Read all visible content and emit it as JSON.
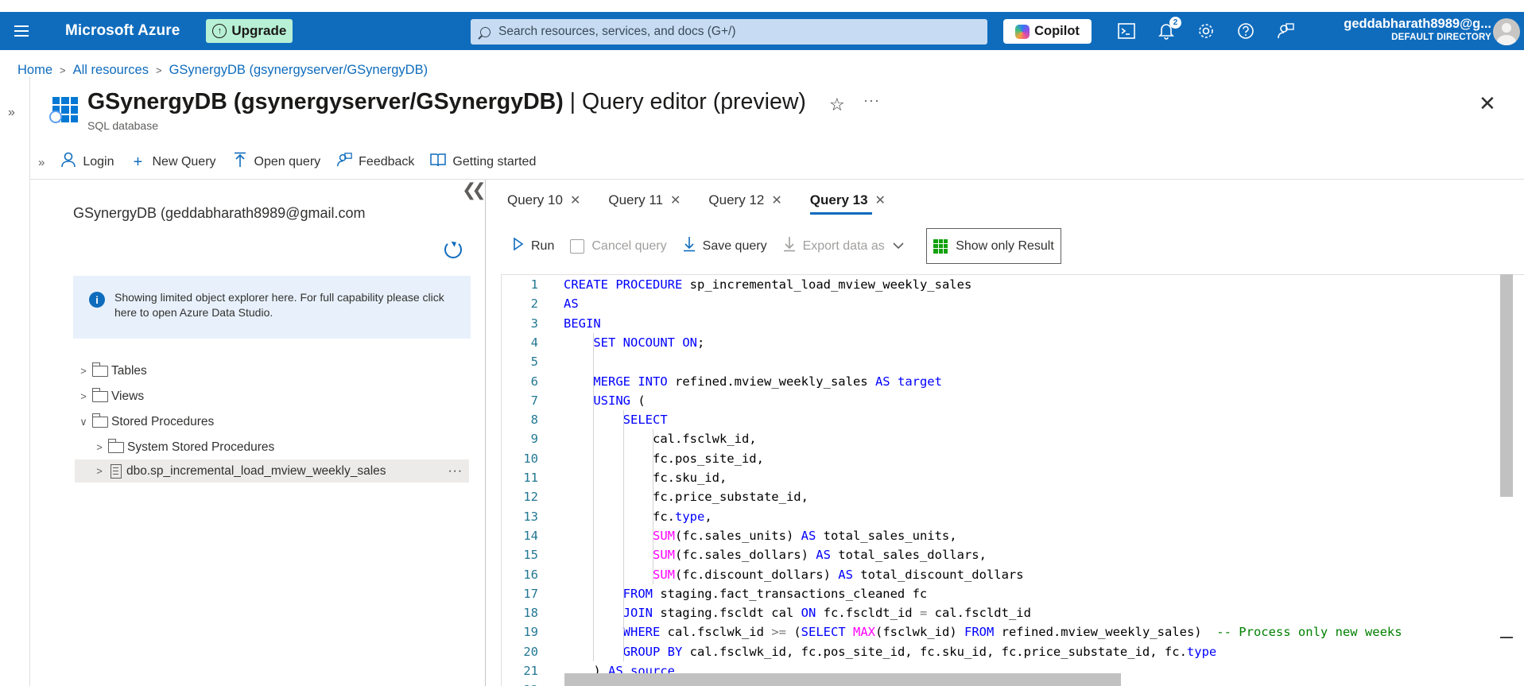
{
  "topbar": {
    "brand": "Microsoft Azure",
    "upgrade_label": "Upgrade",
    "search_placeholder": "Search resources, services, and docs (G+/)",
    "copilot_label": "Copilot",
    "notification_count": "2",
    "account_name": "geddabharath8989@g...",
    "account_directory": "DEFAULT DIRECTORY"
  },
  "breadcrumb": [
    "Home",
    "All resources",
    "GSynergyDB (gsynergyserver/GSynergyDB)"
  ],
  "header": {
    "title_main": "GSynergyDB (gsynergyserver/GSynergyDB)",
    "title_sub": " | Query editor (preview)",
    "subtitle": "SQL database"
  },
  "commands": [
    "Login",
    "New Query",
    "Open query",
    "Feedback",
    "Getting started"
  ],
  "explorer": {
    "db_label": "GSynergyDB (geddabharath8989@gmail.com",
    "info_text": "Showing limited object explorer here. For full capability please click here to open Azure Data Studio.",
    "tree": {
      "tables": "Tables",
      "views": "Views",
      "stored_procedures": "Stored Procedures",
      "system_procs": "System Stored Procedures",
      "proc_item": "dbo.sp_incremental_load_mview_weekly_sales"
    }
  },
  "tabs": [
    "Query 10",
    "Query 11",
    "Query 12",
    "Query 13"
  ],
  "active_tab": "Query 13",
  "query_toolbar": {
    "run": "Run",
    "cancel": "Cancel query",
    "save": "Save query",
    "export": "Export data as",
    "show_result": "Show only Result"
  },
  "code_lines": [
    "CREATE PROCEDURE sp_incremental_load_mview_weekly_sales",
    "AS",
    "BEGIN",
    "    SET NOCOUNT ON;",
    "",
    "    MERGE INTO refined.mview_weekly_sales AS target",
    "    USING (",
    "        SELECT",
    "            cal.fsclwk_id,",
    "            fc.pos_site_id,",
    "            fc.sku_id,",
    "            fc.price_substate_id,",
    "            fc.type,",
    "            SUM(fc.sales_units) AS total_sales_units,",
    "            SUM(fc.sales_dollars) AS total_sales_dollars,",
    "            SUM(fc.discount_dollars) AS total_discount_dollars",
    "        FROM staging.fact_transactions_cleaned fc",
    "        JOIN staging.fscldt cal ON fc.fscldt_id = cal.fscldt_id",
    "        WHERE cal.fsclwk_id >= (SELECT MAX(fsclwk_id) FROM refined.mview_weekly_sales)  -- Process only new weeks",
    "        GROUP BY cal.fsclwk_id, fc.pos_site_id, fc.sku_id, fc.price_substate_id, fc.type",
    "    ) AS source",
    ""
  ]
}
